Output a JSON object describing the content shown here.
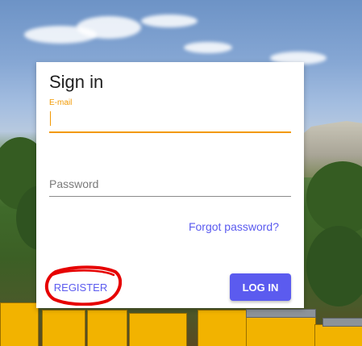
{
  "signin": {
    "title": "Sign in",
    "email_label": "E-mail",
    "email_value": "",
    "password_placeholder": "Password",
    "password_value": "",
    "forgot_link": "Forgot password?",
    "register_button": "REGISTER",
    "login_button": "LOG IN"
  },
  "colors": {
    "accent": "#f29900",
    "primary": "#5b5bef",
    "annotation": "#e60000"
  }
}
